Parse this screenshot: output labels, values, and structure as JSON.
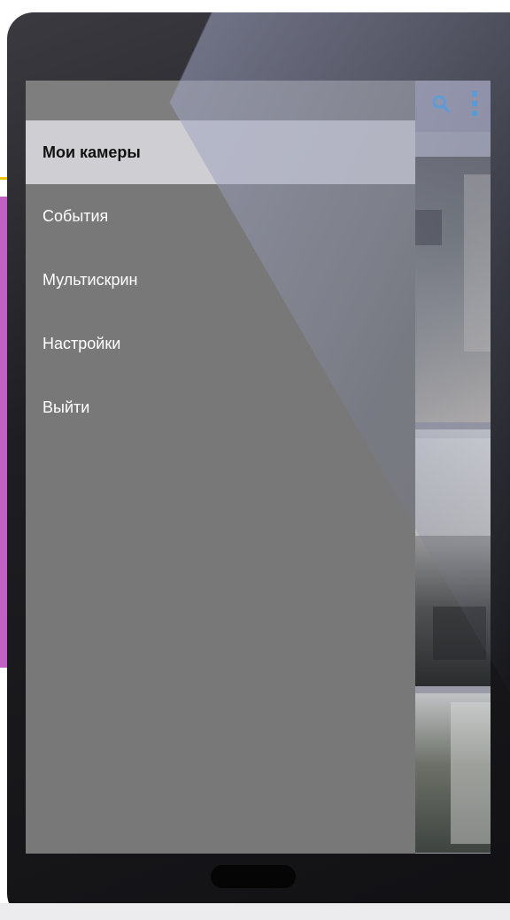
{
  "drawer": {
    "items": [
      {
        "label": "Мои камеры",
        "active": true
      },
      {
        "label": "События",
        "active": false
      },
      {
        "label": "Мультискрин",
        "active": false
      },
      {
        "label": "Настройки",
        "active": false
      },
      {
        "label": "Выйти",
        "active": false
      }
    ]
  },
  "toolbar": {
    "icons": [
      "search-icon",
      "more-vert-icon"
    ]
  },
  "colors": {
    "drawer_bg": "#787878",
    "active_item_bg": "#cfcfd3",
    "accent_yellow": "#f2c400",
    "accent_magenta": "#c062c4"
  }
}
